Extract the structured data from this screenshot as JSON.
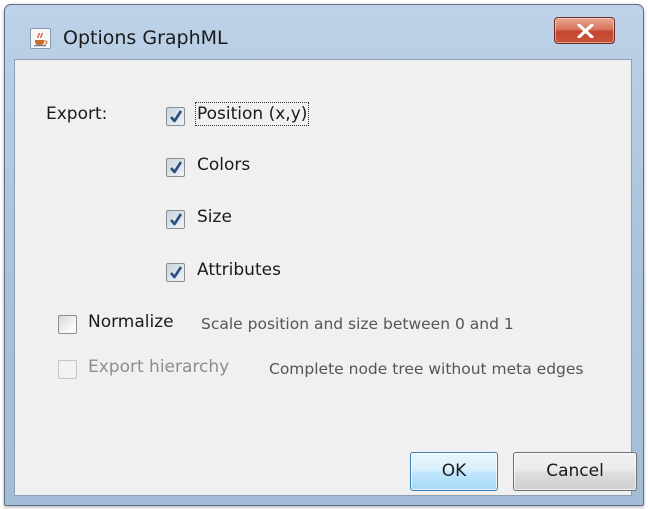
{
  "window": {
    "title": "Options GraphML",
    "icon": "java-cup-icon",
    "close_glyph": "X"
  },
  "export": {
    "label": "Export:",
    "options": [
      {
        "label": "Position (x,y)",
        "checked": true,
        "focused": true
      },
      {
        "label": "Colors",
        "checked": true
      },
      {
        "label": "Size",
        "checked": true
      },
      {
        "label": "Attributes",
        "checked": true
      }
    ]
  },
  "normalize": {
    "label": "Normalize",
    "checked": false,
    "description": "Scale position and size between 0 and 1"
  },
  "export_hierarchy": {
    "label": "Export hierarchy",
    "checked": false,
    "enabled": false,
    "description": "Complete node tree without meta edges"
  },
  "buttons": {
    "ok": "OK",
    "cancel": "Cancel"
  },
  "colors": {
    "check_mark": "#2b4f7a",
    "ok_border": "#3c7fb1",
    "close_red": "#c4452d"
  }
}
